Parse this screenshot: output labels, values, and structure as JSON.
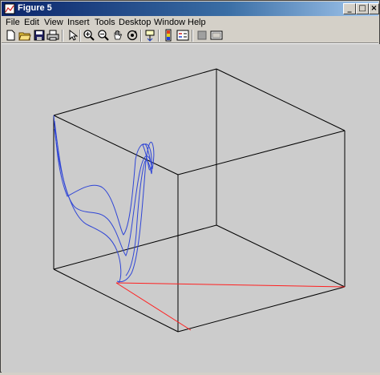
{
  "window": {
    "title": "Figure 5"
  },
  "menu": [
    "File",
    "Edit",
    "View",
    "Insert",
    "Tools",
    "Desktop",
    "Window",
    "Help"
  ],
  "toolbar": [
    {
      "name": "new-figure-icon"
    },
    {
      "name": "open-file-icon"
    },
    {
      "name": "save-icon"
    },
    {
      "name": "print-icon"
    },
    {
      "name": "edit-plot-arrow-icon"
    },
    {
      "name": "zoom-in-icon"
    },
    {
      "name": "zoom-out-icon"
    },
    {
      "name": "pan-hand-icon"
    },
    {
      "name": "rotate-3d-icon"
    },
    {
      "name": "data-cursor-icon"
    },
    {
      "name": "insert-colorbar-icon"
    },
    {
      "name": "insert-legend-icon"
    },
    {
      "name": "hide-plot-tools-icon"
    },
    {
      "name": "show-plot-tools-icon"
    }
  ],
  "colors": {
    "canvas": "#cccccc",
    "blue_curve": "#1f3fd8",
    "red_curve": "#ff2020"
  }
}
